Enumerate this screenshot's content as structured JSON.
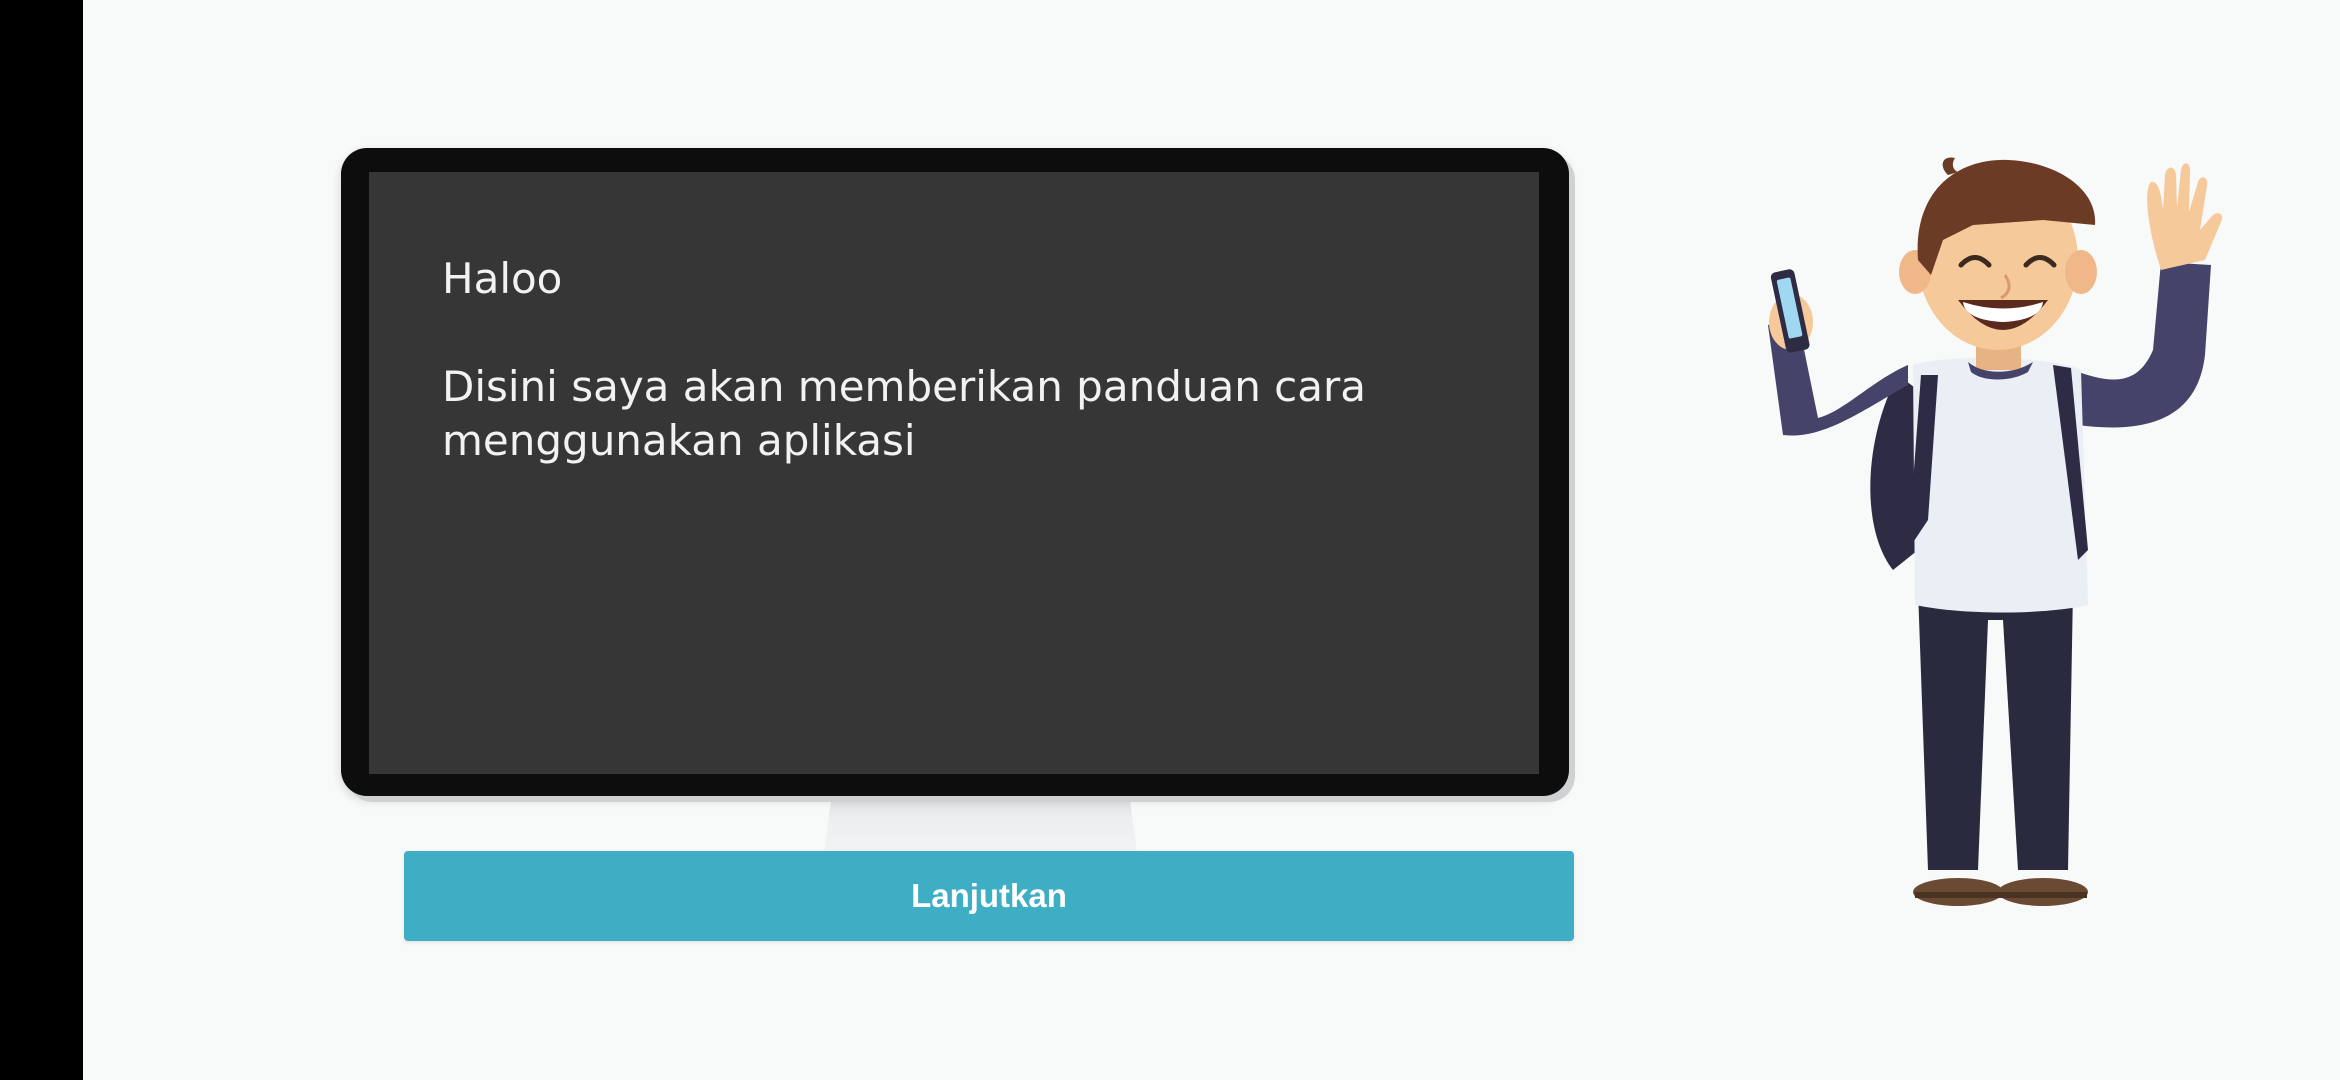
{
  "guide": {
    "greeting": "Haloo",
    "message": "Disini saya akan memberikan panduan cara menggunakan aplikasi"
  },
  "actions": {
    "next_label": "Lanjutkan"
  },
  "colors": {
    "background": "#f8f9f9",
    "screen": "#363636",
    "monitor_frame": "#0d0d0d",
    "button": "#3eaec4",
    "button_text": "#ffffff",
    "text": "#f2f2f2"
  },
  "illustration": {
    "icon": "waving-student-illustration"
  }
}
